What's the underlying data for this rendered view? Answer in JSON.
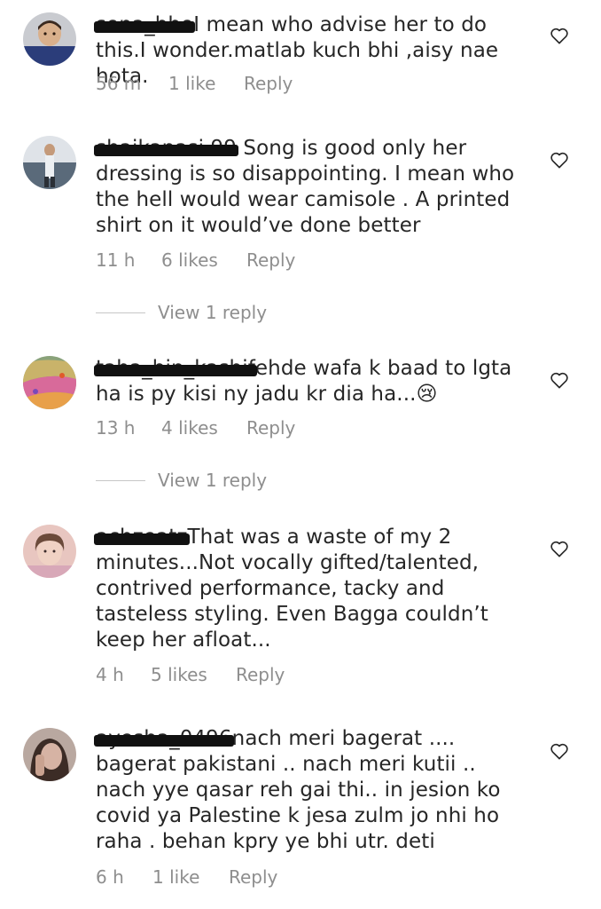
{
  "comments": [
    {
      "username": "sona_bho",
      "text": "I mean who advise her to do this.I wonder.matlab kuch bhi ,aisy nae hota.",
      "time": "56 m",
      "likes": "1 like",
      "reply": "Reply"
    },
    {
      "username": "shaikanasi.99",
      "text": "Song is good only her dressing is so disappointing. I mean who the hell would wear camisole . A printed shirt on it would’ve done better",
      "time": "11 h",
      "likes": "6 likes",
      "reply": "Reply",
      "view_replies": "View 1 reply"
    },
    {
      "username": "taha_bin_kashif",
      "text": "ehde wafa k baad to lgta ha is py kisi ny jadu kr dia ha...",
      "emoji": "😢",
      "time": "13 h",
      "likes": "4 likes",
      "reply": "Reply",
      "view_replies": "View 1 reply"
    },
    {
      "username": "achzeatz",
      "text": "That was a waste of my 2 minutes...Not vocally gifted/talented, contrived performance, tacky and tasteless styling. Even Bagga couldn’t keep her afloat...",
      "time": "4 h",
      "likes": "5 likes",
      "reply": "Reply"
    },
    {
      "username": "ayesha_0496",
      "text": "nach meri bagerat .... bagerat pakistani .. nach meri kutii .. nach yye qasar reh gai thi.. in jesion ko covid ya Palestine k jesa zulm jo nhi ho raha . behan kpry ye bhi utr. deti",
      "time": "6 h",
      "likes": "1 like",
      "reply": "Reply"
    }
  ],
  "colors": {
    "text": "#262626",
    "meta": "#8e8e8e",
    "divider": "#c7c7c7"
  },
  "icons": {
    "like": "heart-outline-icon"
  }
}
